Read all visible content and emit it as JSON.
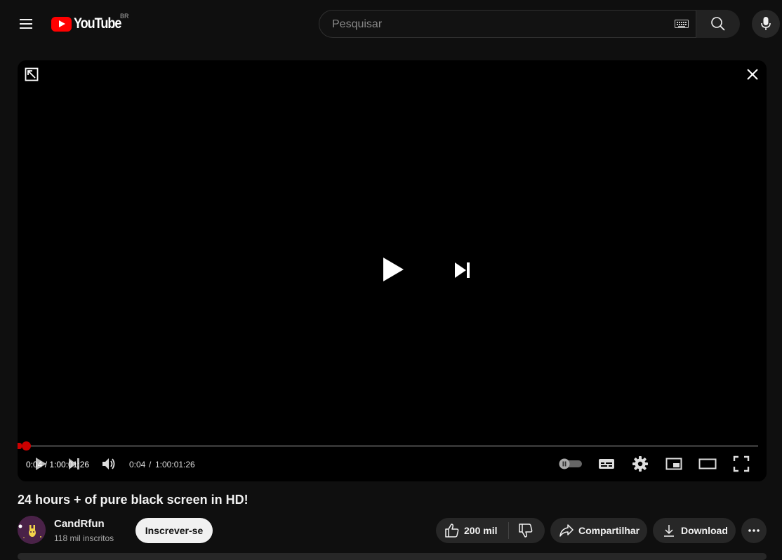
{
  "header": {
    "logo_text": "YouTube",
    "logo_region": "BR",
    "search_placeholder": "Pesquisar"
  },
  "player": {
    "progress": 0.001,
    "time_current": "0:04",
    "time_separator": "/",
    "time_total": "1:00:01:26",
    "time_overlay": "0:04 / 1:00:01:26",
    "accent_color": "#cc0000"
  },
  "video": {
    "title": "24 hours + of pure black screen in HD!"
  },
  "channel": {
    "name": "CandRfun",
    "subscribers": "118 mil inscritos",
    "subscribe_label": "Inscrever-se"
  },
  "actions": {
    "likes": "200 mil",
    "share_label": "Compartilhar",
    "download_label": "Download"
  }
}
